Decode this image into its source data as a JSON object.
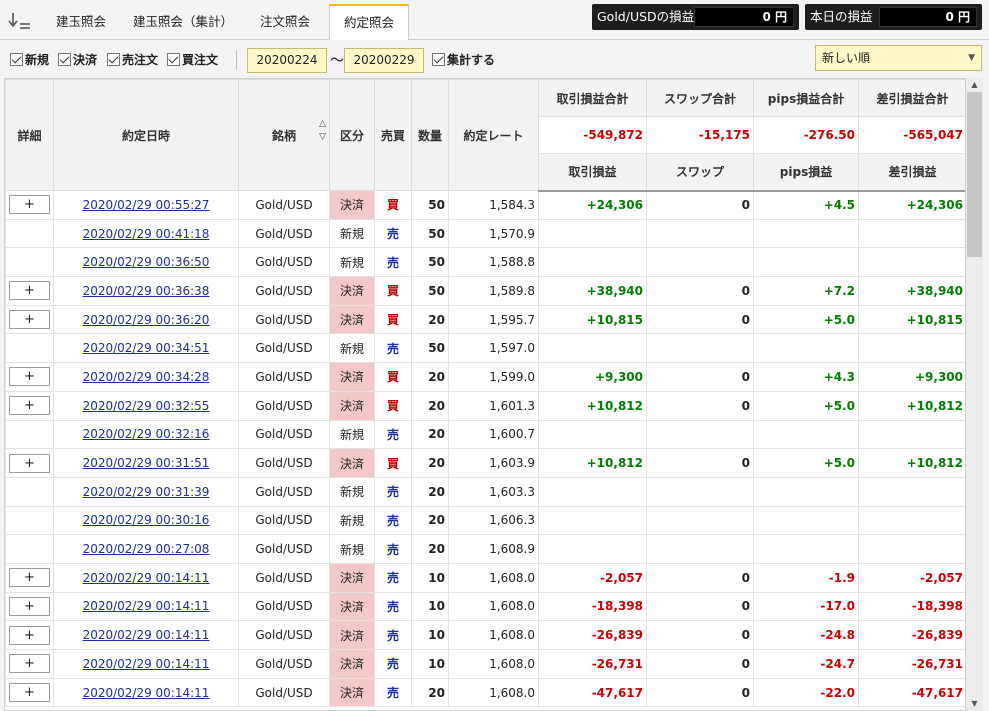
{
  "tabs": [
    {
      "label": "建玉照会",
      "active": false
    },
    {
      "label": "建玉照会（集計）",
      "active": false
    },
    {
      "label": "注文照会",
      "active": false
    },
    {
      "label": "約定照会",
      "active": true
    }
  ],
  "pl_boxes": [
    {
      "label": "Gold/USDの損益",
      "value": "0 円"
    },
    {
      "label": "本日の損益",
      "value": "0 円"
    }
  ],
  "filters": {
    "checkboxes": [
      {
        "label": "新規",
        "checked": true
      },
      {
        "label": "決済",
        "checked": true
      },
      {
        "label": "売注文",
        "checked": true
      },
      {
        "label": "買注文",
        "checked": true
      }
    ],
    "date_from": "20200224",
    "date_sep": "〜",
    "date_to": "20200229",
    "aggregate_label": "集計する",
    "aggregate_checked": true,
    "sort_selected": "新しい順"
  },
  "table": {
    "headers": {
      "detail": "詳細",
      "datetime": "約定日時",
      "symbol": "銘柄",
      "kind": "区分",
      "side": "売買",
      "qty": "数量",
      "rate": "約定レート",
      "sum_trade": "取引損益合計",
      "sum_swap": "スワップ合計",
      "sum_pips": "pips損益合計",
      "sum_net": "差引損益合計",
      "trade": "取引損益",
      "swap": "スワップ",
      "pips": "pips損益",
      "net": "差引損益"
    },
    "totals": {
      "trade": "-549,872",
      "swap": "-15,175",
      "pips": "-276.50",
      "net": "-565,047"
    },
    "rows": [
      {
        "detail": "+",
        "datetime": "2020/02/29 00:55:27",
        "symbol": "Gold/USD",
        "kind": "決済",
        "side": "買",
        "qty": "50",
        "rate": "1,584.3",
        "trade": "+24,306",
        "swap": "0",
        "pips": "+4.5",
        "net": "+24,306"
      },
      {
        "detail": "",
        "datetime": "2020/02/29 00:41:18",
        "symbol": "Gold/USD",
        "kind": "新規",
        "side": "売",
        "qty": "50",
        "rate": "1,570.9",
        "trade": "",
        "swap": "",
        "pips": "",
        "net": ""
      },
      {
        "detail": "",
        "datetime": "2020/02/29 00:36:50",
        "symbol": "Gold/USD",
        "kind": "新規",
        "side": "売",
        "qty": "50",
        "rate": "1,588.8",
        "trade": "",
        "swap": "",
        "pips": "",
        "net": ""
      },
      {
        "detail": "+",
        "datetime": "2020/02/29 00:36:38",
        "symbol": "Gold/USD",
        "kind": "決済",
        "side": "買",
        "qty": "50",
        "rate": "1,589.8",
        "trade": "+38,940",
        "swap": "0",
        "pips": "+7.2",
        "net": "+38,940"
      },
      {
        "detail": "+",
        "datetime": "2020/02/29 00:36:20",
        "symbol": "Gold/USD",
        "kind": "決済",
        "side": "買",
        "qty": "20",
        "rate": "1,595.7",
        "trade": "+10,815",
        "swap": "0",
        "pips": "+5.0",
        "net": "+10,815"
      },
      {
        "detail": "",
        "datetime": "2020/02/29 00:34:51",
        "symbol": "Gold/USD",
        "kind": "新規",
        "side": "売",
        "qty": "50",
        "rate": "1,597.0",
        "trade": "",
        "swap": "",
        "pips": "",
        "net": ""
      },
      {
        "detail": "+",
        "datetime": "2020/02/29 00:34:28",
        "symbol": "Gold/USD",
        "kind": "決済",
        "side": "買",
        "qty": "20",
        "rate": "1,599.0",
        "trade": "+9,300",
        "swap": "0",
        "pips": "+4.3",
        "net": "+9,300"
      },
      {
        "detail": "+",
        "datetime": "2020/02/29 00:32:55",
        "symbol": "Gold/USD",
        "kind": "決済",
        "side": "買",
        "qty": "20",
        "rate": "1,601.3",
        "trade": "+10,812",
        "swap": "0",
        "pips": "+5.0",
        "net": "+10,812"
      },
      {
        "detail": "",
        "datetime": "2020/02/29 00:32:16",
        "symbol": "Gold/USD",
        "kind": "新規",
        "side": "売",
        "qty": "20",
        "rate": "1,600.7",
        "trade": "",
        "swap": "",
        "pips": "",
        "net": ""
      },
      {
        "detail": "+",
        "datetime": "2020/02/29 00:31:51",
        "symbol": "Gold/USD",
        "kind": "決済",
        "side": "買",
        "qty": "20",
        "rate": "1,603.9",
        "trade": "+10,812",
        "swap": "0",
        "pips": "+5.0",
        "net": "+10,812"
      },
      {
        "detail": "",
        "datetime": "2020/02/29 00:31:39",
        "symbol": "Gold/USD",
        "kind": "新規",
        "side": "売",
        "qty": "20",
        "rate": "1,603.3",
        "trade": "",
        "swap": "",
        "pips": "",
        "net": ""
      },
      {
        "detail": "",
        "datetime": "2020/02/29 00:30:16",
        "symbol": "Gold/USD",
        "kind": "新規",
        "side": "売",
        "qty": "20",
        "rate": "1,606.3",
        "trade": "",
        "swap": "",
        "pips": "",
        "net": ""
      },
      {
        "detail": "",
        "datetime": "2020/02/29 00:27:08",
        "symbol": "Gold/USD",
        "kind": "新規",
        "side": "売",
        "qty": "20",
        "rate": "1,608.9",
        "trade": "",
        "swap": "",
        "pips": "",
        "net": ""
      },
      {
        "detail": "+",
        "datetime": "2020/02/29 00:14:11",
        "symbol": "Gold/USD",
        "kind": "決済",
        "side": "売",
        "qty": "10",
        "rate": "1,608.0",
        "trade": "-2,057",
        "swap": "0",
        "pips": "-1.9",
        "net": "-2,057"
      },
      {
        "detail": "+",
        "datetime": "2020/02/29 00:14:11",
        "symbol": "Gold/USD",
        "kind": "決済",
        "side": "売",
        "qty": "10",
        "rate": "1,608.0",
        "trade": "-18,398",
        "swap": "0",
        "pips": "-17.0",
        "net": "-18,398"
      },
      {
        "detail": "+",
        "datetime": "2020/02/29 00:14:11",
        "symbol": "Gold/USD",
        "kind": "決済",
        "side": "売",
        "qty": "10",
        "rate": "1,608.0",
        "trade": "-26,839",
        "swap": "0",
        "pips": "-24.8",
        "net": "-26,839"
      },
      {
        "detail": "+",
        "datetime": "2020/02/29 00:14:11",
        "symbol": "Gold/USD",
        "kind": "決済",
        "side": "売",
        "qty": "10",
        "rate": "1,608.0",
        "trade": "-26,731",
        "swap": "0",
        "pips": "-24.7",
        "net": "-26,731"
      },
      {
        "detail": "+",
        "datetime": "2020/02/29 00:14:11",
        "symbol": "Gold/USD",
        "kind": "決済",
        "side": "売",
        "qty": "20",
        "rate": "1,608.0",
        "trade": "-47,617",
        "swap": "0",
        "pips": "-22.0",
        "net": "-47,617"
      }
    ]
  },
  "colors": {
    "positive": "#008000",
    "negative": "#d00000",
    "buy": "#c00000",
    "sell": "#1a2ea8",
    "kessai_bg": "#f2c8c8",
    "input_bg": "#fff8c8",
    "tab_accent": "#f0c000"
  }
}
